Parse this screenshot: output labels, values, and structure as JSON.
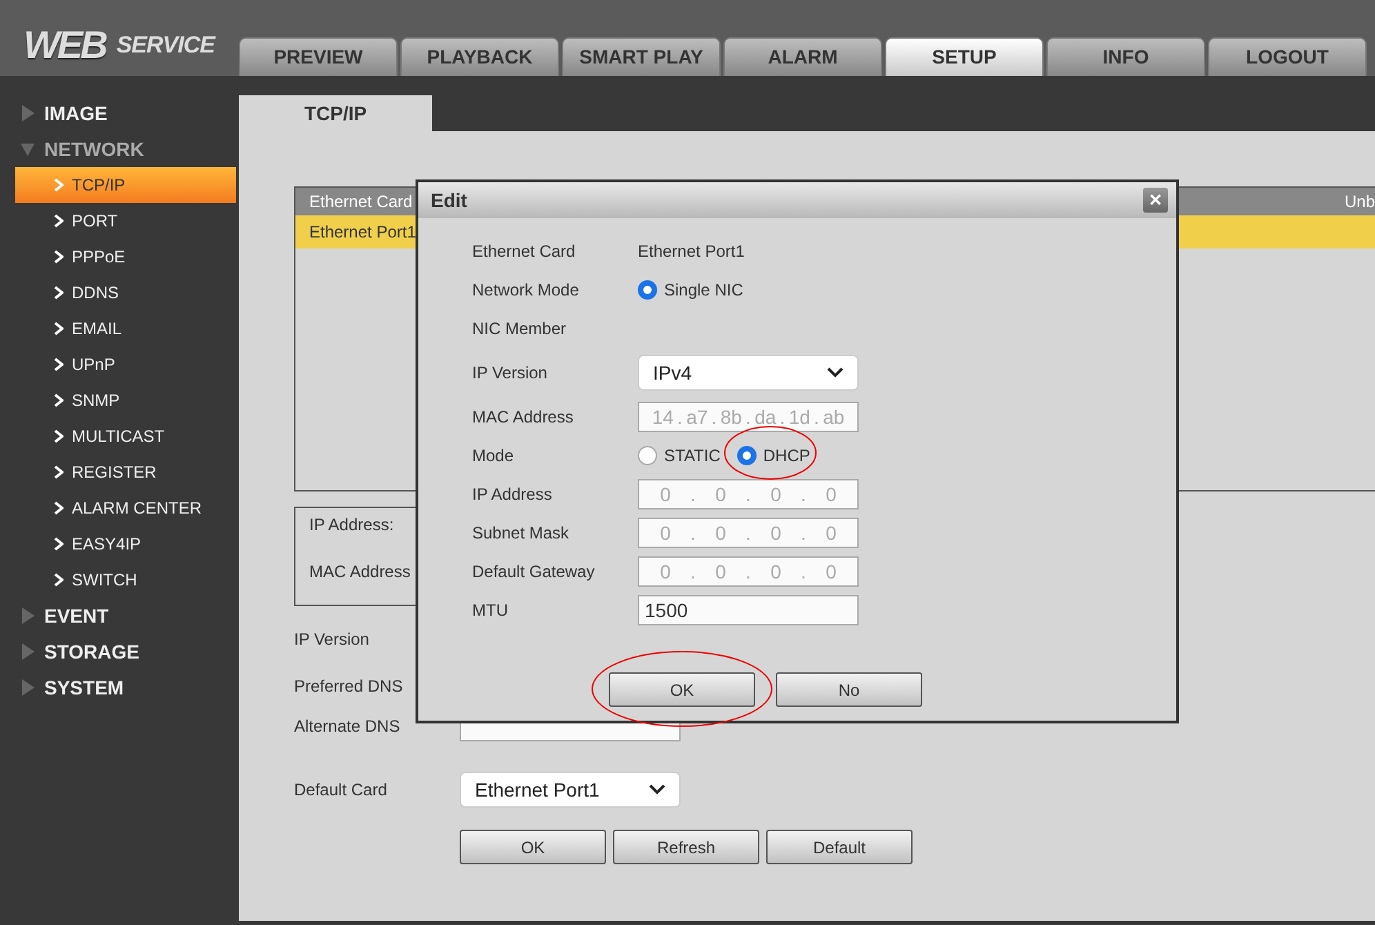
{
  "logo": {
    "primary": "WEB",
    "secondary": "SERVICE"
  },
  "tabs": [
    {
      "label": "PREVIEW",
      "selected": false
    },
    {
      "label": "PLAYBACK",
      "selected": false
    },
    {
      "label": "SMART PLAY",
      "selected": false
    },
    {
      "label": "ALARM",
      "selected": false
    },
    {
      "label": "SETUP",
      "selected": true
    },
    {
      "label": "INFO",
      "selected": false
    },
    {
      "label": "LOGOUT",
      "selected": false
    }
  ],
  "sidebar": {
    "items": [
      {
        "label": "IMAGE",
        "expanded": false
      },
      {
        "label": "NETWORK",
        "expanded": true,
        "children": [
          {
            "label": "TCP/IP",
            "selected": true
          },
          {
            "label": "PORT",
            "selected": false
          },
          {
            "label": "PPPoE",
            "selected": false
          },
          {
            "label": "DDNS",
            "selected": false
          },
          {
            "label": "EMAIL",
            "selected": false
          },
          {
            "label": "UPnP",
            "selected": false
          },
          {
            "label": "SNMP",
            "selected": false
          },
          {
            "label": "MULTICAST",
            "selected": false
          },
          {
            "label": "REGISTER",
            "selected": false
          },
          {
            "label": "ALARM CENTER",
            "selected": false
          },
          {
            "label": "EASY4IP",
            "selected": false
          },
          {
            "label": "SWITCH",
            "selected": false
          }
        ]
      },
      {
        "label": "EVENT",
        "expanded": false
      },
      {
        "label": "STORAGE",
        "expanded": false
      },
      {
        "label": "SYSTEM",
        "expanded": false
      }
    ]
  },
  "page_tab": "TCP/IP",
  "card_table": {
    "columns": [
      "Ethernet Card",
      "Unb"
    ],
    "rows": [
      {
        "ethernet_card": "Ethernet Port1",
        "selected": true
      }
    ]
  },
  "info_box": {
    "labels": [
      "IP Address:",
      "MAC Address"
    ]
  },
  "form": {
    "ip_version_label": "IP Version",
    "preferred_dns_label": "Preferred DNS",
    "alternate_dns": {
      "label": "Alternate DNS"
    },
    "default_card": {
      "label": "Default Card",
      "value": "Ethernet Port1"
    },
    "buttons": [
      "OK",
      "Refresh",
      "Default"
    ]
  },
  "dialog": {
    "title": "Edit",
    "close": "✕",
    "rows": [
      {
        "kind": "text",
        "label": "Ethernet Card",
        "value": "Ethernet Port1"
      },
      {
        "kind": "radio",
        "label": "Network Mode",
        "options": [
          {
            "label": "Single NIC",
            "selected": true
          }
        ]
      },
      {
        "kind": "empty",
        "label": "NIC Member"
      },
      {
        "kind": "select",
        "label": "IP Version",
        "value": "IPv4"
      },
      {
        "kind": "ip",
        "label": "MAC Address",
        "parts": [
          "14",
          "a7",
          "8b",
          "da",
          "1d",
          "ab"
        ],
        "separator": ".",
        "disabled": true
      },
      {
        "kind": "radio",
        "label": "Mode",
        "options": [
          {
            "label": "STATIC",
            "selected": false
          },
          {
            "label": "DHCP",
            "selected": true,
            "circled": true
          }
        ]
      },
      {
        "kind": "ip",
        "label": "IP Address",
        "parts": [
          "0",
          "0",
          "0",
          "0"
        ],
        "separator": ".",
        "disabled": true
      },
      {
        "kind": "ip",
        "label": "Subnet Mask",
        "parts": [
          "0",
          "0",
          "0",
          "0"
        ],
        "separator": ".",
        "disabled": true
      },
      {
        "kind": "ip",
        "label": "Default Gateway",
        "parts": [
          "0",
          "0",
          "0",
          "0"
        ],
        "separator": ".",
        "disabled": true
      },
      {
        "kind": "input",
        "label": "MTU",
        "value": "1500"
      }
    ],
    "buttons": [
      {
        "label": "OK",
        "circled": true
      },
      {
        "label": "No"
      }
    ]
  }
}
